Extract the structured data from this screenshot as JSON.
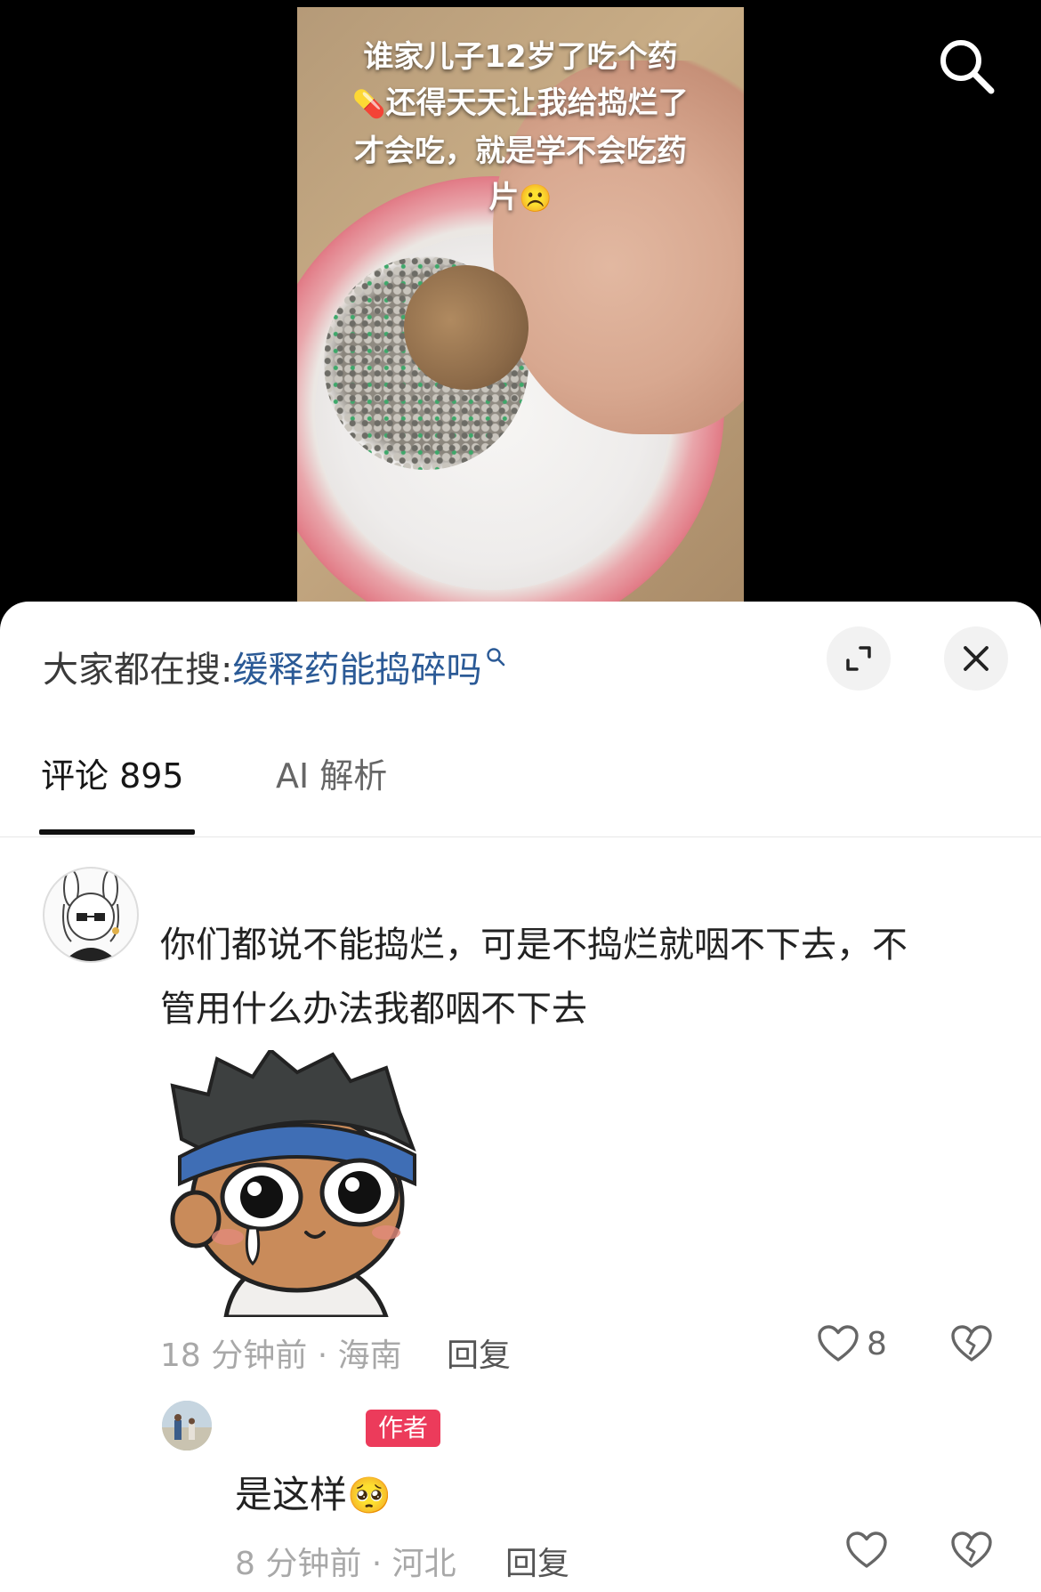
{
  "video": {
    "caption_lines": [
      "谁家儿子12岁了吃个药",
      "还得天天让我给捣烂了",
      "才会吃，就是学不会吃药",
      "片"
    ],
    "pill_emoji": "💊",
    "frown_emoji": "☹️"
  },
  "hot_search": {
    "prefix": "大家都在搜:",
    "term": "缓释药能捣碎吗"
  },
  "tabs": [
    {
      "label": "评论 895",
      "active": true
    },
    {
      "label": "AI 解析",
      "active": false
    }
  ],
  "comments": [
    {
      "text_line1": "你们都说不能捣烂，可是不捣烂就咽不下去，不",
      "text_line2": "管用什么办法我都咽不下去",
      "meta": "18 分钟前 · 海南",
      "reply_label": "回复",
      "likes": "8"
    }
  ],
  "reply_comment": {
    "badge": "作者",
    "text": "是这样",
    "emoji": "🥺",
    "meta": "8 分钟前 · 河北",
    "reply_label": "回复"
  },
  "colors": {
    "accent_link": "#2b5a96",
    "author_badge": "#ec3b5b",
    "meta_text": "#a8a8a8"
  },
  "icons": [
    "search-icon",
    "expand-icon",
    "close-icon",
    "heart-icon",
    "broken-heart-icon"
  ]
}
